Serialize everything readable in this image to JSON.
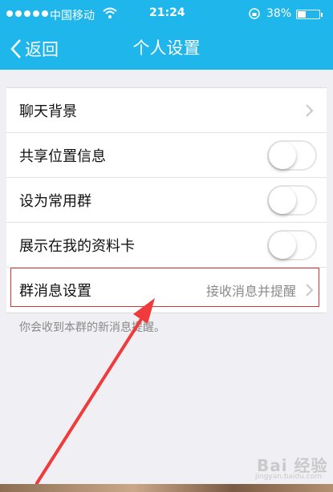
{
  "status_bar": {
    "carrier": "中国移动",
    "time": "21:24",
    "battery": "38%"
  },
  "nav": {
    "back_label": "返回",
    "title": "个人设置"
  },
  "settings": {
    "chat_background": "聊天背景",
    "share_location": "共享位置信息",
    "share_location_on": false,
    "set_common_group": "设为常用群",
    "set_common_group_on": false,
    "show_on_profile": "展示在我的资料卡",
    "show_on_profile_on": false,
    "group_message_settings": "群消息设置",
    "group_message_value": "接收消息并提醒"
  },
  "hint": "你会收到本群的新消息提醒。",
  "watermark": {
    "brand": "Bai 经验",
    "url": "jingyan.baidu.com"
  },
  "colors": {
    "header": "#1fb6ec",
    "highlight": "#d9333a"
  }
}
